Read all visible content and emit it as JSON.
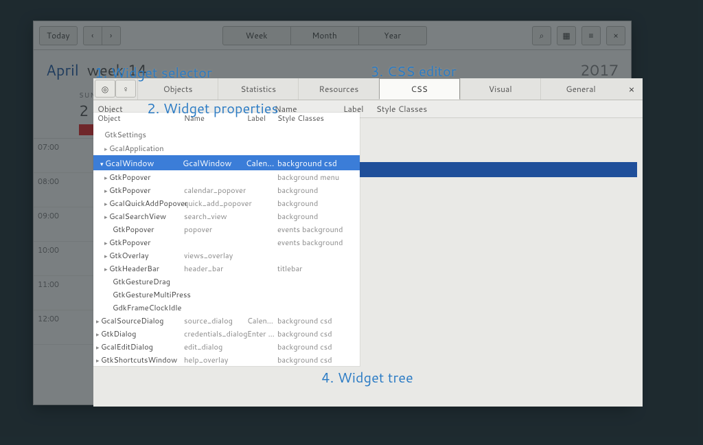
{
  "calendar": {
    "today_btn": "Today",
    "views": {
      "week": "Week",
      "month": "Month",
      "year": "Year"
    },
    "month": "April",
    "week_label": "week 14",
    "year": "2017",
    "day": {
      "dow": "SUN",
      "dom": "2"
    },
    "times": [
      "07:00",
      "08:00",
      "09:00",
      "10:00",
      "11:00",
      "12:00"
    ]
  },
  "inspector": {
    "tabs": [
      "Objects",
      "Statistics",
      "Resources",
      "CSS",
      "Visual",
      "General"
    ],
    "active_tab": "CSS",
    "columns": {
      "object": "Object",
      "name": "Name",
      "label": "Label",
      "style": "Style Classes"
    },
    "pre_rows": [
      "GtkSettings",
      "GcalApplication"
    ],
    "selected": {
      "object": "GcalWindow",
      "name": "GcalWindow",
      "label": "Calen…",
      "style": "background csd"
    },
    "children": [
      {
        "exp": true,
        "object": "GtkPopover",
        "name": "",
        "label": "",
        "style": "background menu"
      },
      {
        "exp": true,
        "object": "GtkPopover",
        "name": "calendar_popover",
        "label": "",
        "style": "background"
      },
      {
        "exp": true,
        "object": "GcalQuickAddPopover",
        "name": "quick_add_popover",
        "label": "",
        "style": "background"
      },
      {
        "exp": true,
        "object": "GcalSearchView",
        "name": "search_view",
        "label": "",
        "style": "background"
      },
      {
        "exp": false,
        "object": "GtkPopover",
        "name": "popover",
        "label": "",
        "style": "events background"
      },
      {
        "exp": true,
        "object": "GtkPopover",
        "name": "",
        "label": "",
        "style": "events background"
      },
      {
        "exp": true,
        "object": "GtkOverlay",
        "name": "views_overlay",
        "label": "",
        "style": ""
      },
      {
        "exp": true,
        "object": "GtkHeaderBar",
        "name": "header_bar",
        "label": "",
        "style": "titlebar"
      },
      {
        "exp": false,
        "object": "GtkGestureDrag",
        "name": "",
        "label": "",
        "style": ""
      },
      {
        "exp": false,
        "object": "GtkGestureMultiPress",
        "name": "",
        "label": "",
        "style": ""
      },
      {
        "exp": false,
        "object": "GdkFrameClockIdle",
        "name": "",
        "label": "",
        "style": ""
      }
    ],
    "siblings": [
      {
        "exp": true,
        "object": "GcalSourceDialog",
        "name": "source_dialog",
        "label": "Calen…",
        "style": "background csd"
      },
      {
        "exp": true,
        "object": "GtkDialog",
        "name": "credentials_dialog",
        "label": "Enter …",
        "style": "background csd"
      },
      {
        "exp": true,
        "object": "GcalEditDialog",
        "name": "edit_dialog",
        "label": "",
        "style": "background csd"
      },
      {
        "exp": true,
        "object": "GtkShortcutsWindow",
        "name": "help_overlay",
        "label": "",
        "style": "background csd"
      }
    ]
  },
  "annotations": {
    "a1": "1. Widget selector",
    "a2": "2. Widget properties",
    "a3": "3. CSS editor",
    "a4": "4. Widget tree"
  }
}
